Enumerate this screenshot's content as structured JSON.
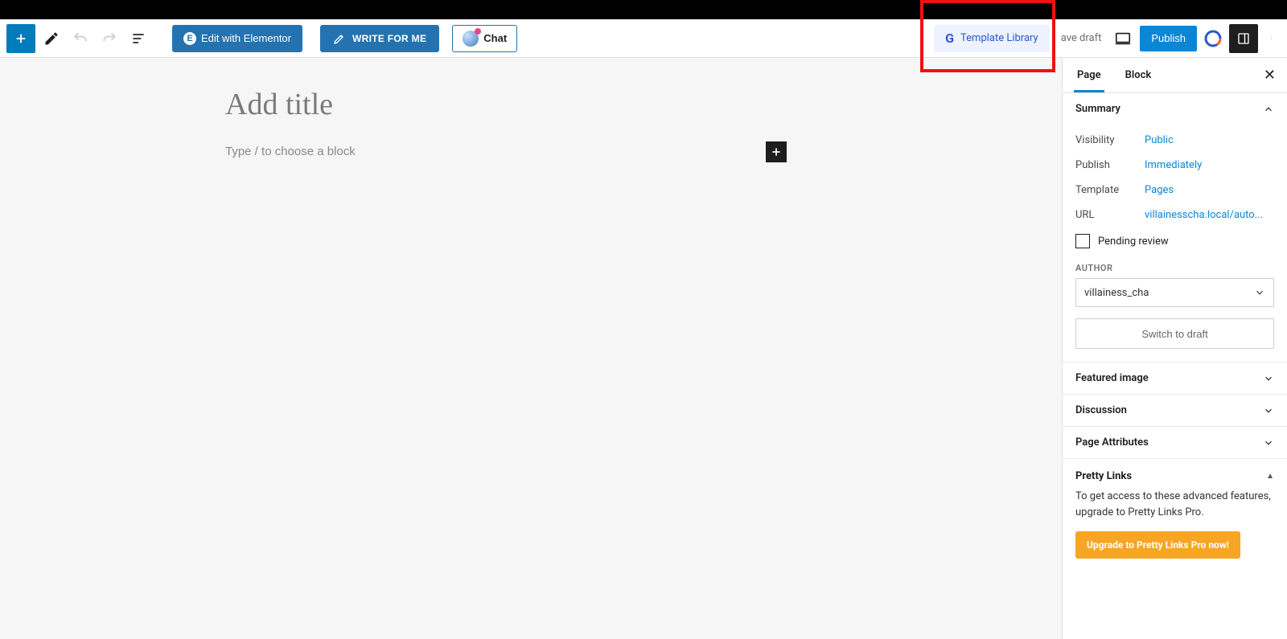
{
  "toolbar": {
    "elementor_label": "Edit with Elementor",
    "write_label": "WRITE FOR ME",
    "chat_label": "Chat",
    "template_library_label": "Template Library",
    "save_draft_label": "ave draft",
    "publish_label": "Publish"
  },
  "editor": {
    "title_placeholder": "Add title",
    "block_placeholder": "Type / to choose a block"
  },
  "sidebar": {
    "tabs": {
      "page": "Page",
      "block": "Block"
    },
    "summary": {
      "heading": "Summary",
      "visibility_label": "Visibility",
      "visibility_value": "Public",
      "publish_label": "Publish",
      "publish_value": "Immediately",
      "template_label": "Template",
      "template_value": "Pages",
      "url_label": "URL",
      "url_value": "villainesscha.local/auto...",
      "pending_review_label": "Pending review",
      "author_heading": "AUTHOR",
      "author_value": "villainess_cha",
      "switch_draft_label": "Switch to draft"
    },
    "sections": {
      "featured_image": "Featured image",
      "discussion": "Discussion",
      "page_attributes": "Page Attributes"
    },
    "pretty_links": {
      "heading": "Pretty Links",
      "text": "To get access to these advanced features, upgrade to Pretty Links Pro.",
      "cta": "Upgrade to Pretty Links Pro now!"
    }
  }
}
